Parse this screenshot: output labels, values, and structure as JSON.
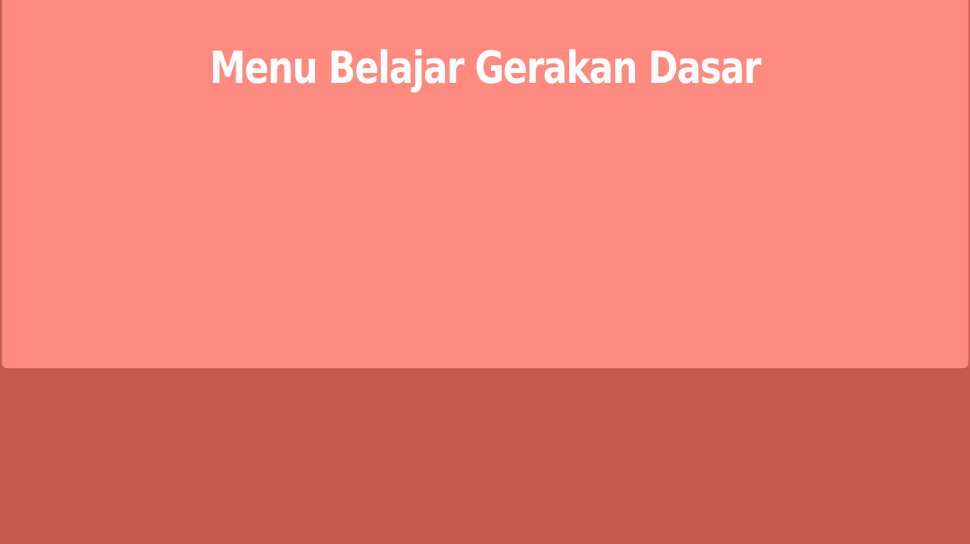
{
  "page": {
    "title": "Menu Belajar Gerakan Dasar"
  },
  "colors": {
    "panel": "#ff8a7f",
    "background": "#c55a52",
    "title_text": "#ffffff"
  }
}
